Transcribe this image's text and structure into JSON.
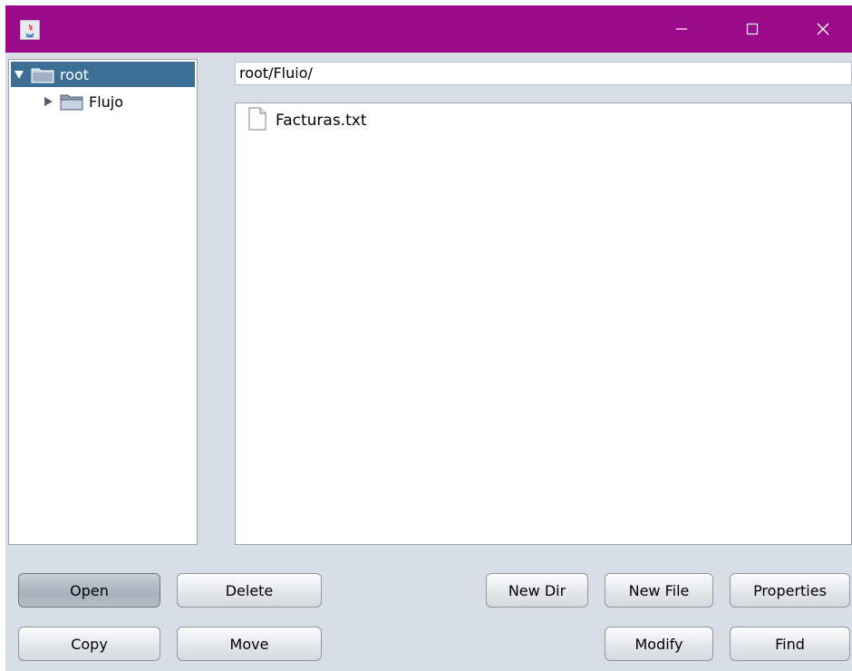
{
  "window": {
    "controls": {
      "minimize": "—",
      "maximize": "☐",
      "close": "✕"
    },
    "title_color": "#9a0a8a"
  },
  "tree": {
    "items": [
      {
        "label": "root",
        "expanded": true,
        "selected": true
      },
      {
        "label": "Flujo",
        "expanded": false,
        "selected": false
      }
    ]
  },
  "path": {
    "value": "root/Fluio/"
  },
  "files": [
    {
      "label": "Facturas.txt",
      "icon": "text-file-icon"
    }
  ],
  "buttons": {
    "open": "Open",
    "delete": "Delete",
    "new_dir": "New Dir",
    "new_file": "New File",
    "properties": "Properties",
    "copy": "Copy",
    "move": "Move",
    "modify": "Modify",
    "find": "Find"
  },
  "colors": {
    "selection": "#3b6f95",
    "panel_background": "#d9dde5"
  }
}
